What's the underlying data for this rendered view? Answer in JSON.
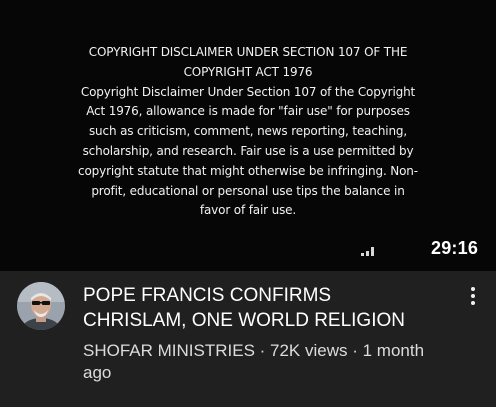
{
  "thumbnail": {
    "disclaimer_lines": [
      "COPYRIGHT DISCLAIMER UNDER SECTION 107 OF THE",
      "COPYRIGHT ACT 1976",
      "Copyright Disclaimer Under Section 107 of the Copyright",
      "Act 1976, allowance is made for \"fair use\" for purposes",
      "such as criticism, comment, news reporting, teaching,",
      "scholarship, and research. Fair use is a use permitted by",
      "copyright statute that might otherwise be infringing. Non-",
      "profit, educational or personal use tips the balance in",
      "favor of fair use."
    ],
    "duration": "29:16",
    "indicator_icon": "signal-bars-icon"
  },
  "video": {
    "title_lines": [
      "POPE FRANCIS CONFIRMS",
      "CHRISLAM, ONE WORLD RELIGION"
    ],
    "meta_lines": [
      "SHOFAR MINISTRIES · 72K views · 1 month",
      "ago"
    ],
    "avatar_icon": "channel-avatar",
    "menu_icon": "more-vert-icon"
  },
  "colors": {
    "thumbnail_bg": "#060606",
    "panel_bg": "#202020",
    "title_text": "#ffffff",
    "meta_text": "#dcdcdc"
  }
}
